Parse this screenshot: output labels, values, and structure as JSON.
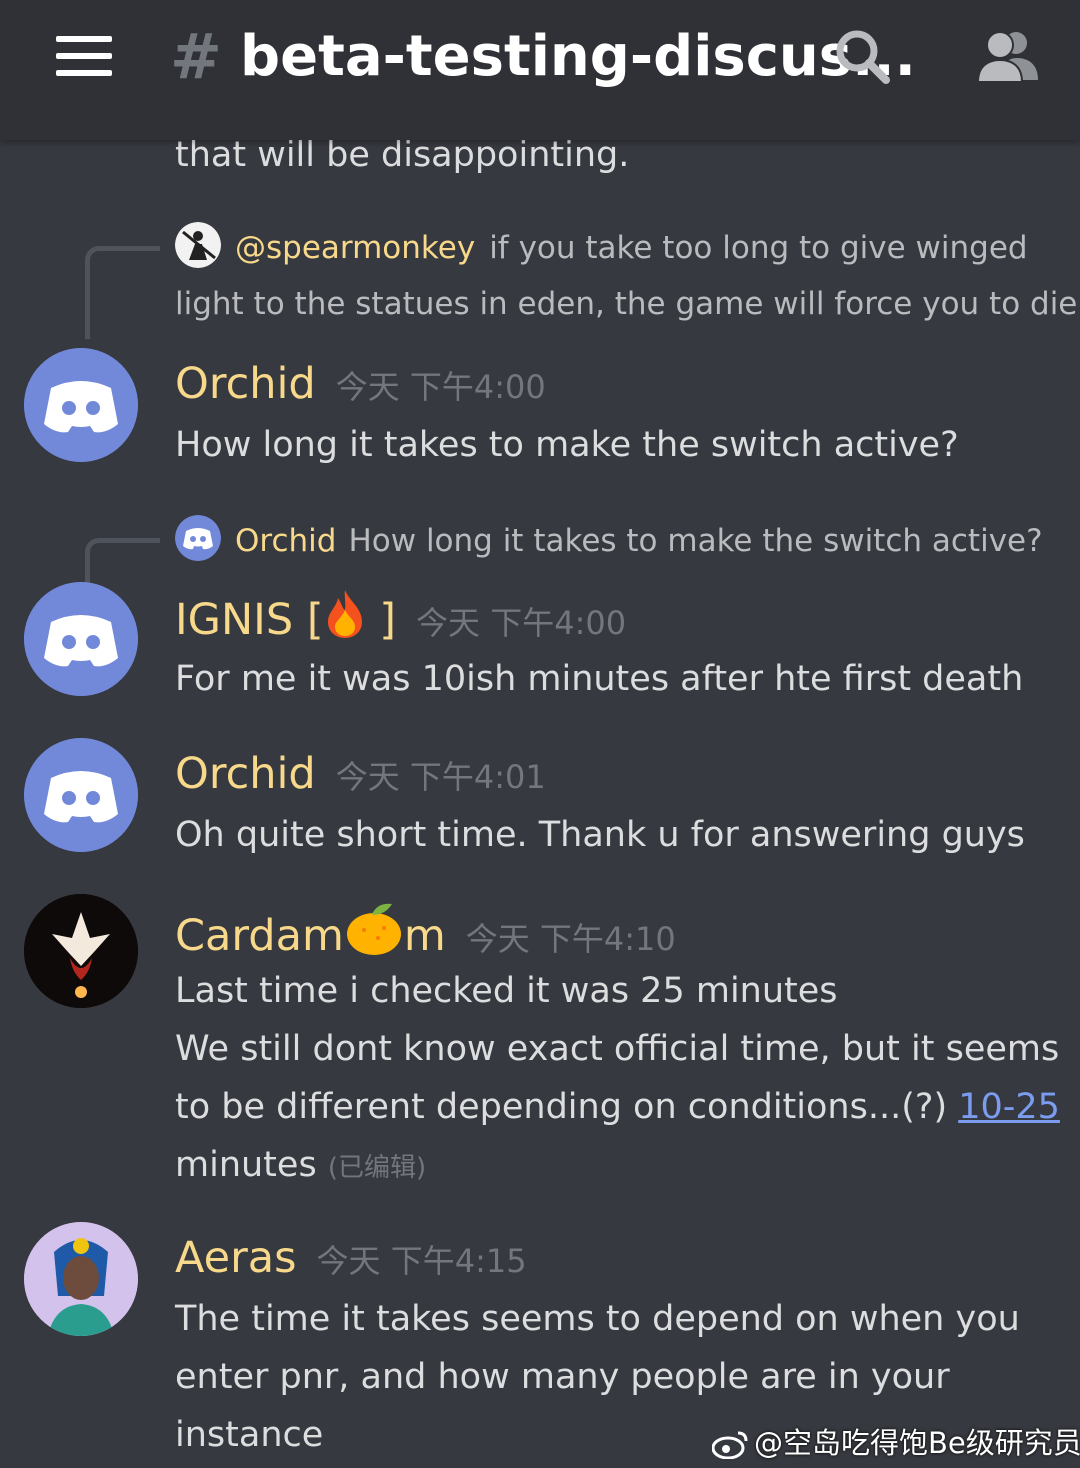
{
  "header": {
    "hash": "#",
    "channel_name": "beta-testing-discus..."
  },
  "icons": {
    "menu": "hamburger-icon",
    "search": "search-icon",
    "members": "members-icon"
  },
  "colors": {
    "background": "#36393f",
    "header": "#2f3136",
    "username": "#f8d98b",
    "blurple": "#7289da",
    "link": "#7c9cf0"
  },
  "messages": {
    "top_fragment": "that will be disappointing.",
    "reply1": {
      "mention": "@spearmonkey",
      "line1": "if you take too long to give winged",
      "line2": "light to the statues in eden, the game will force you to die"
    },
    "m1": {
      "user": "Orchid",
      "time": "今天 下午4:00",
      "text": "How long it takes to make the switch active?"
    },
    "reply2": {
      "user": "Orchid",
      "text": "How long it takes to make the switch active?"
    },
    "m2": {
      "user_prefix": "IGNIS [",
      "user_suffix": "]",
      "time": "今天 下午4:00",
      "text": "For me it was 10ish minutes after hte first death"
    },
    "m3": {
      "user": "Orchid",
      "time": "今天 下午4:01",
      "text": "Oh quite short time. Thank u for answering guys"
    },
    "m4": {
      "user_prefix": "Cardam",
      "user_suffix": "m",
      "time": "今天 下午4:10",
      "line1": "Last time i checked it was 25 minutes",
      "line2": "We still dont know exact official time, but it seems",
      "line3": "to be different depending on conditions...(?) ",
      "link": "10-25",
      "line4": "minutes",
      "edited": "(已编辑)"
    },
    "m5": {
      "user": "Aeras",
      "time": "今天 下午4:15",
      "line1": "The time it takes seems to depend on when you",
      "line2": "enter pnr, and how many people are in your",
      "line3": "instance"
    }
  },
  "watermark": "@空岛吃得饱Be级研究员"
}
